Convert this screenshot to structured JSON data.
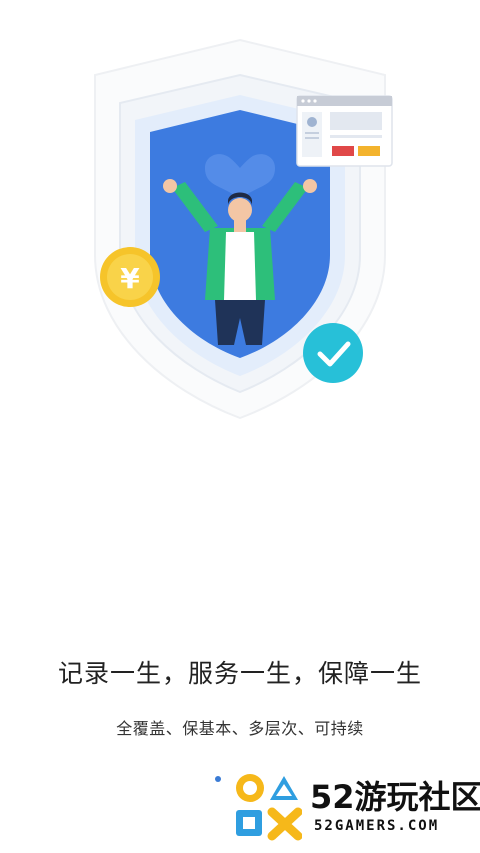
{
  "hero": {
    "currency_symbol": "¥",
    "icons": [
      "shield-icon",
      "person-illustration",
      "yuan-coin-icon",
      "checkmark-icon",
      "browser-card-icon"
    ]
  },
  "tagline": "记录一生，服务一生，保障一生",
  "subline": "全覆盖、保基本、多层次、可持续",
  "pagination": {
    "active": 1
  },
  "watermark": {
    "brand": "52游玩社区",
    "domain": "52GAMERS.COM"
  },
  "colors": {
    "shield_blue": "#3d7be0",
    "coin_yellow": "#f6c42a",
    "check_cyan": "#27c0d8",
    "jacket_green": "#2dbf7a"
  }
}
